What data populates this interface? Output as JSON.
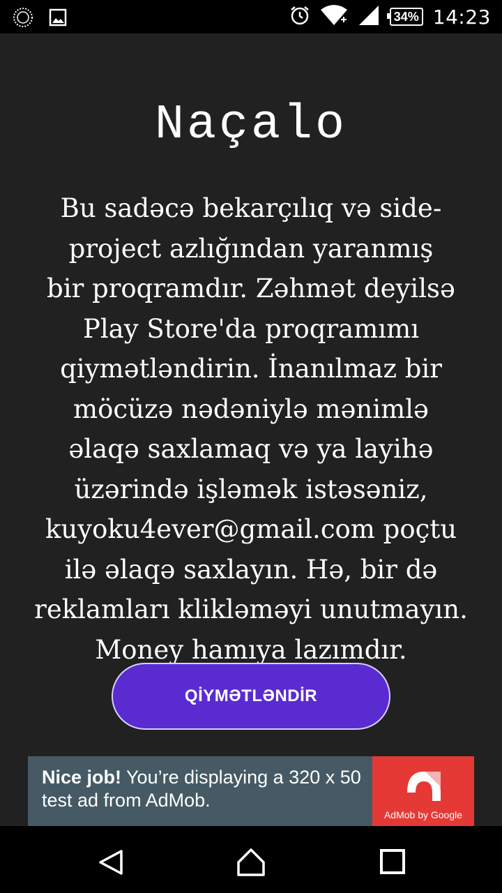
{
  "status_bar": {
    "icons_left": [
      "circle-app-icon",
      "image-icon"
    ],
    "icons_right": [
      "alarm-icon",
      "wifi-icon",
      "signal-icon"
    ],
    "battery": "34%",
    "time": "14:23"
  },
  "main": {
    "title": "Naçalo",
    "paragraph_lines": [
      "Bu sadəcə bekarçılıq və side-",
      "project azlığından yaranmış",
      "bir proqramdır. Zəhmət deyilsə",
      "Play Store'da proqramımı",
      "qiymətləndirin. İnanılmaz bir",
      "möcüzə nədəniylə mənimlə",
      "əlaqə saxlamaq və ya layihə",
      "üzərində işləmək istəsəniz,",
      "kuyoku4ever@gmail.com poçtu",
      "ilə əlaqə saxlayın. Hə, bir də",
      "reklamları klikləməyi unutmayın.",
      "Money hamıya lazımdır."
    ],
    "rate_button": "QİYMƏTLƏNDİR"
  },
  "ad": {
    "bold": "Nice job!",
    "text": " You’re displaying a 320 x 50 test ad from AdMob.",
    "logo_caption": "AdMob by Google",
    "colors": {
      "background": "#455a64",
      "logo_bg": "#e53935"
    }
  },
  "nav_bar": {
    "buttons": [
      "back-icon",
      "home-icon",
      "recents-icon"
    ]
  },
  "colors": {
    "background": "#212121",
    "button": "#5a2bd0"
  }
}
